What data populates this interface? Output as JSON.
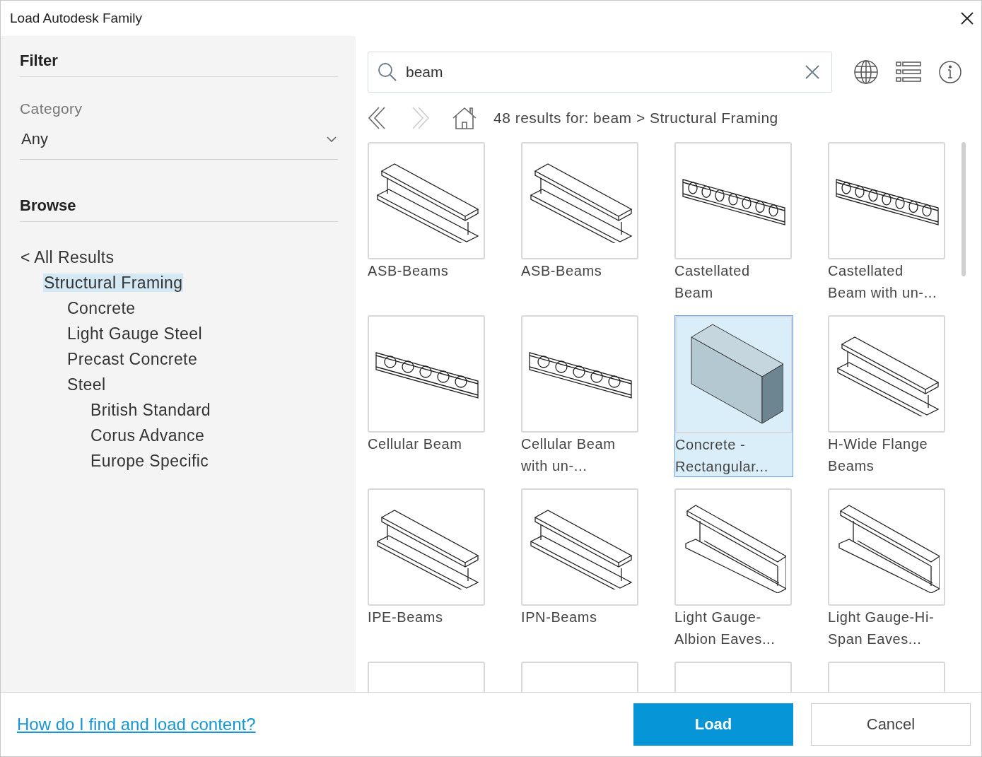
{
  "window": {
    "title": "Load Autodesk Family"
  },
  "filter": {
    "heading": "Filter",
    "category_label": "Category",
    "category_value": "Any"
  },
  "browse": {
    "heading": "Browse",
    "tree": [
      {
        "label": "< All Results",
        "selected": false,
        "children": [
          {
            "label": "Structural Framing",
            "selected": true,
            "children": [
              {
                "label": "Concrete",
                "selected": false
              },
              {
                "label": "Light Gauge Steel",
                "selected": false
              },
              {
                "label": "Precast Concrete",
                "selected": false
              },
              {
                "label": "Steel",
                "selected": false,
                "children": [
                  {
                    "label": "British Standard",
                    "selected": false
                  },
                  {
                    "label": "Corus Advance",
                    "selected": false
                  },
                  {
                    "label": "Europe Specific",
                    "selected": false
                  }
                ]
              }
            ]
          }
        ]
      }
    ]
  },
  "search": {
    "value": "beam"
  },
  "breadcrumb": {
    "back_disabled": false,
    "forward_disabled": true,
    "text": "48 results for: beam > Structural Framing"
  },
  "results": [
    {
      "name": "ASB-Beams",
      "kind": "i-beam",
      "selected": false
    },
    {
      "name": "ASB-Beams",
      "kind": "i-beam",
      "selected": false
    },
    {
      "name": "Castellated Beam",
      "kind": "castellated",
      "selected": false
    },
    {
      "name": "Castellated Beam with un-...",
      "kind": "castellated",
      "selected": false
    },
    {
      "name": "Cellular Beam",
      "kind": "cellular",
      "selected": false
    },
    {
      "name": "Cellular Beam with un-...",
      "kind": "cellular",
      "selected": false
    },
    {
      "name": "Concrete - Rectangular...",
      "kind": "block",
      "selected": true
    },
    {
      "name": "H-Wide Flange Beams",
      "kind": "i-beam",
      "selected": false
    },
    {
      "name": "IPE-Beams",
      "kind": "i-beam",
      "selected": false
    },
    {
      "name": "IPN-Beams",
      "kind": "i-beam",
      "selected": false
    },
    {
      "name": "Light Gauge-Albion Eaves...",
      "kind": "channel",
      "selected": false
    },
    {
      "name": "Light Gauge-Hi-Span Eaves...",
      "kind": "channel",
      "selected": false
    },
    {
      "kind": "partial",
      "selected": false
    },
    {
      "kind": "partial",
      "selected": false
    },
    {
      "kind": "partial",
      "selected": false
    },
    {
      "kind": "partial",
      "selected": false
    }
  ],
  "footer": {
    "help_link": "How do I find and load content?",
    "buttons": [
      {
        "label": "Load",
        "kind": "primary"
      },
      {
        "label": "Cancel",
        "kind": "secondary"
      }
    ]
  }
}
